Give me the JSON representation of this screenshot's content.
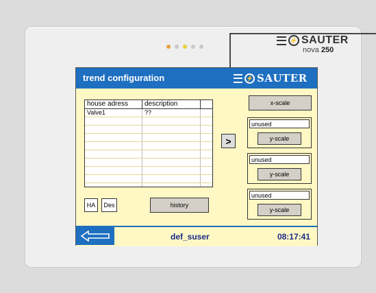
{
  "device": {
    "brand": "SAUTER",
    "model_prefix": "nova",
    "model_number": "250",
    "leds": [
      "#e8a040",
      "#c8c8c8",
      "#e8d040",
      "#c8c8c8",
      "#c8c8c8"
    ]
  },
  "screen": {
    "title": "trend configuration",
    "logo_text": "SAUTER",
    "accent": "#1e6fc0",
    "background": "#fff8c4",
    "table": {
      "columns": [
        "house adress",
        "description",
        ""
      ],
      "rows": [
        [
          "Valve1",
          "??",
          ""
        ],
        [
          "",
          "",
          ""
        ],
        [
          "",
          "",
          ""
        ],
        [
          "",
          "",
          ""
        ],
        [
          "",
          "",
          ""
        ],
        [
          "",
          "",
          ""
        ],
        [
          "",
          "",
          ""
        ],
        [
          "",
          "",
          ""
        ],
        [
          "",
          "",
          ""
        ],
        [
          "",
          "",
          ""
        ]
      ]
    },
    "arrow_label": ">",
    "ha_label": "HA",
    "des_label": "Des",
    "history_label": "history",
    "x_scale_label": "x-scale",
    "y_groups": [
      {
        "value": "unused",
        "button": "y-scale"
      },
      {
        "value": "unused",
        "button": "y-scale"
      },
      {
        "value": "unused",
        "button": "y-scale"
      }
    ],
    "footer": {
      "user": "def_suser",
      "time": "08:17:41"
    }
  }
}
